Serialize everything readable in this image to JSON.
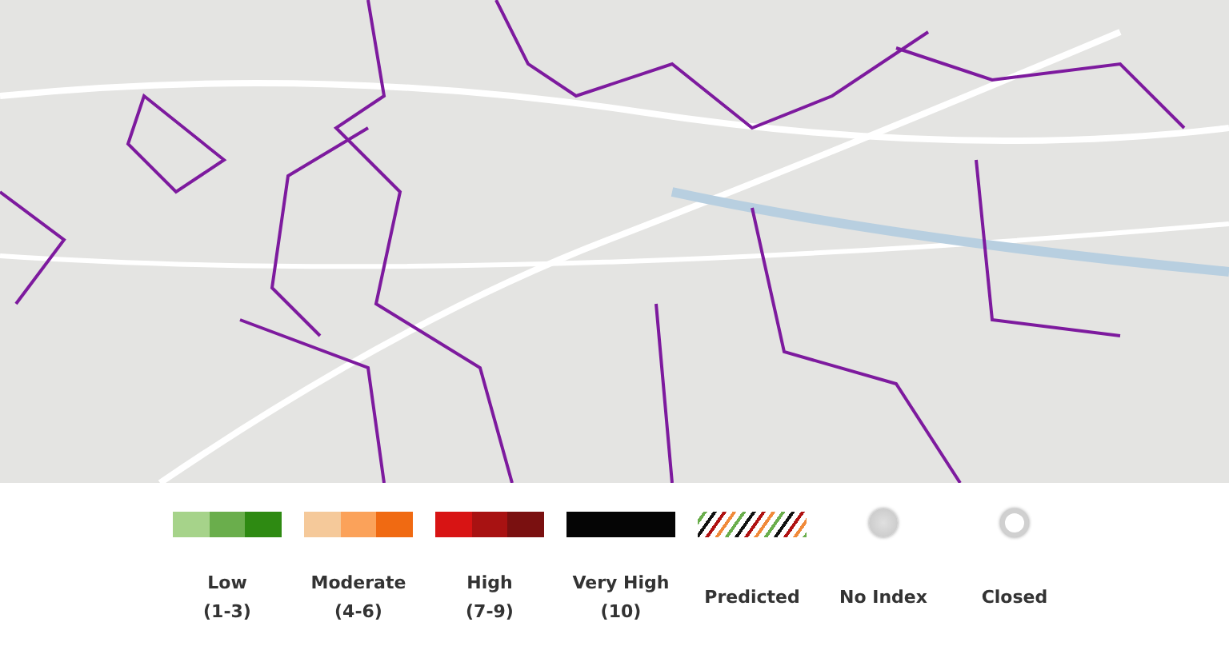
{
  "legend": [
    {
      "kind": "scale",
      "label": "Low",
      "range": "(1-3)",
      "segments": [
        {
          "color": "#a6d38a"
        },
        {
          "color": "#6aae4c"
        },
        {
          "color": "#2e8a12"
        }
      ]
    },
    {
      "kind": "scale",
      "label": "Moderate",
      "range": "(4-6)",
      "segments": [
        {
          "color": "#f5c99a"
        },
        {
          "color": "#fba25a"
        },
        {
          "color": "#f06a12"
        }
      ]
    },
    {
      "kind": "scale",
      "label": "High",
      "range": "(7-9)",
      "segments": [
        {
          "color": "#d81414"
        },
        {
          "color": "#a81212"
        },
        {
          "color": "#7a1010"
        }
      ]
    },
    {
      "kind": "scale",
      "label": "Very High",
      "range": "(10)",
      "segments": [
        {
          "color": "#050505"
        }
      ]
    },
    {
      "kind": "hatched",
      "label": "Predicted"
    },
    {
      "kind": "no-index",
      "label": "No Index"
    },
    {
      "kind": "closed",
      "label": "Closed"
    }
  ]
}
